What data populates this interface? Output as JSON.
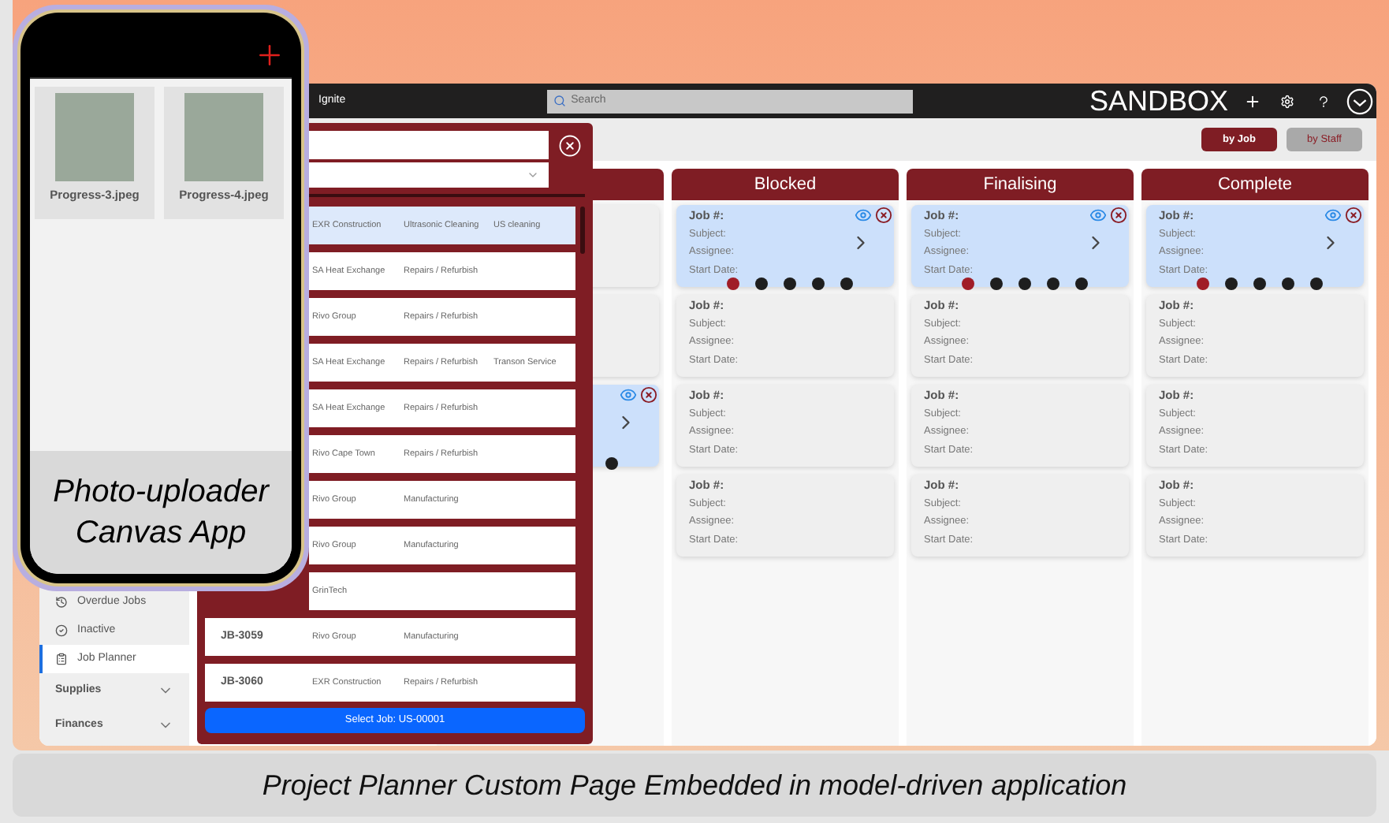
{
  "app": {
    "brand": "Ignite",
    "search_placeholder": "Search",
    "environment": "SANDBOX"
  },
  "sidebar": {
    "items": [
      {
        "label": "Overdue Jobs",
        "kind": "nav",
        "selected": false
      },
      {
        "label": "Inactive",
        "kind": "nav",
        "selected": false
      },
      {
        "label": "Job Planner",
        "kind": "nav",
        "selected": true
      },
      {
        "label": "Supplies",
        "kind": "group",
        "expanded": false
      },
      {
        "label": "Finances",
        "kind": "group",
        "expanded": false
      }
    ]
  },
  "view_toggle": [
    {
      "label": "by Job",
      "selected": true
    },
    {
      "label": "by Staff",
      "selected": false
    }
  ],
  "columns": [
    {
      "cards": [
        {
          "highlighted": false
        },
        {
          "highlighted": false
        },
        {
          "highlighted": true,
          "dots": [
            {
              "selected": false
            }
          ]
        }
      ]
    },
    {
      "title": "Blocked",
      "cards": [
        {
          "highlighted": true,
          "fields": [
            "Job #:",
            "Subject:",
            "Assignee:",
            "Start Date:"
          ],
          "dots": [
            {
              "selected": true
            },
            {
              "selected": false
            },
            {
              "selected": false
            },
            {
              "selected": false
            },
            {
              "selected": false
            }
          ]
        },
        {
          "highlighted": false,
          "fields": [
            "Job #:",
            "Subject:",
            "Assignee:",
            "Start Date:"
          ]
        },
        {
          "highlighted": false,
          "fields": [
            "Job #:",
            "Subject:",
            "Assignee:",
            "Start Date:"
          ]
        },
        {
          "highlighted": false,
          "fields": [
            "Job #:",
            "Subject:",
            "Assignee:",
            "Start Date:"
          ]
        }
      ]
    },
    {
      "title": "Finalising",
      "cards": [
        {
          "highlighted": true,
          "fields": [
            "Job #:",
            "Subject:",
            "Assignee:",
            "Start Date:"
          ],
          "dots": [
            {
              "selected": true
            },
            {
              "selected": false
            },
            {
              "selected": false
            },
            {
              "selected": false
            },
            {
              "selected": false
            }
          ]
        },
        {
          "highlighted": false,
          "fields": [
            "Job #:",
            "Subject:",
            "Assignee:",
            "Start Date:"
          ]
        },
        {
          "highlighted": false,
          "fields": [
            "Job #:",
            "Subject:",
            "Assignee:",
            "Start Date:"
          ]
        },
        {
          "highlighted": false,
          "fields": [
            "Job #:",
            "Subject:",
            "Assignee:",
            "Start Date:"
          ]
        }
      ]
    },
    {
      "title": "Complete",
      "cards": [
        {
          "highlighted": true,
          "fields": [
            "Job #:",
            "Subject:",
            "Assignee:",
            "Start Date:"
          ],
          "dots": [
            {
              "selected": true
            },
            {
              "selected": false
            },
            {
              "selected": false
            },
            {
              "selected": false
            },
            {
              "selected": false
            }
          ]
        },
        {
          "highlighted": false,
          "fields": [
            "Job #:",
            "Subject:",
            "Assignee:",
            "Start Date:"
          ]
        },
        {
          "highlighted": false,
          "fields": [
            "Job #:",
            "Subject:",
            "Assignee:",
            "Start Date:"
          ]
        },
        {
          "highlighted": false,
          "fields": [
            "Job #:",
            "Subject:",
            "Assignee:",
            "Start Date:"
          ]
        }
      ]
    }
  ],
  "job_picker": {
    "rows": [
      {
        "customer": "EXR Construction",
        "type": "Ultrasonic Cleaning",
        "note": "US cleaning",
        "selected": true
      },
      {
        "customer": "SA Heat Exchange",
        "type": "Repairs / Refurbish",
        "selected": false
      },
      {
        "customer": "Rivo Group",
        "type": "Repairs / Refurbish",
        "selected": false
      },
      {
        "customer": "SA Heat Exchange",
        "type": "Repairs / Refurbish",
        "note": "Transon Service",
        "selected": false
      },
      {
        "customer": "SA Heat Exchange",
        "type": "Repairs / Refurbish",
        "selected": false
      },
      {
        "customer": "Rivo Cape Town",
        "type": "Repairs / Refurbish",
        "selected": false
      },
      {
        "customer": "Rivo Group",
        "type": "Manufacturing",
        "selected": false
      },
      {
        "customer": "Rivo Group",
        "type": "Manufacturing",
        "selected": false
      },
      {
        "customer": "GrinTech",
        "selected": false
      },
      {
        "job": "JB-3059",
        "customer": "Rivo Group",
        "type": "Manufacturing",
        "selected": false
      },
      {
        "job": "JB-3060",
        "customer": "EXR Construction",
        "type": "Repairs / Refurbish",
        "selected": false
      }
    ],
    "button": "Select Job: US-00001"
  },
  "phone": {
    "photos": [
      {
        "name": "Progress-3.jpeg"
      },
      {
        "name": "Progress-4.jpeg"
      }
    ],
    "label": "Photo-uploader Canvas App"
  },
  "caption": "Project Planner Custom Page Embedded in model-driven application"
}
